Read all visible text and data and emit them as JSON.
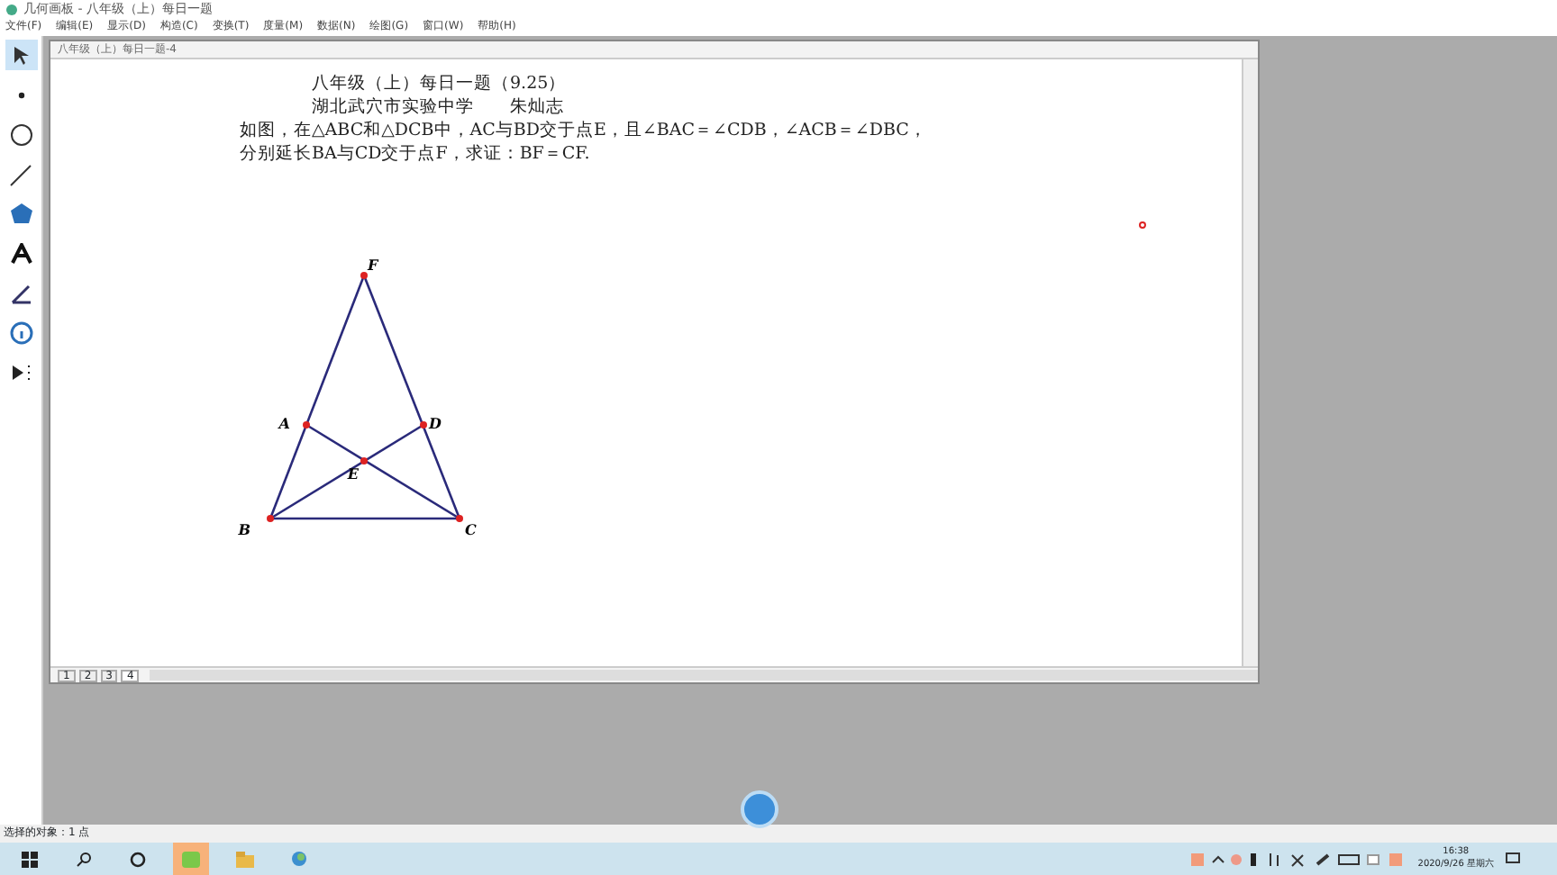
{
  "window": {
    "title": "几何画板 - 八年级（上）每日一题"
  },
  "menu": [
    "文件(F)",
    "编辑(E)",
    "显示(D)",
    "构造(C)",
    "变换(T)",
    "度量(M)",
    "数据(N)",
    "绘图(G)",
    "窗口(W)",
    "帮助(H)"
  ],
  "document": {
    "title": "八年级（上）每日一题-4",
    "lines": [
      {
        "text": "八年级（上）每日一题（9.25）",
        "kind": "center"
      },
      {
        "text": "湖北武穴市实验中学　　朱灿志",
        "kind": "center"
      },
      {
        "text": "如图，在△ABC和△DCB中，AC与BD交于点E，且∠BAC＝∠CDB，∠ACB＝∠DBC，",
        "kind": "left"
      },
      {
        "text": "分别延长BA与CD交于点F，求证：BF＝CF.",
        "kind": "left"
      }
    ],
    "points": [
      {
        "label": "F"
      },
      {
        "label": "A"
      },
      {
        "label": "D"
      },
      {
        "label": "E"
      },
      {
        "label": "B"
      },
      {
        "label": "C"
      }
    ],
    "pages": [
      {
        "label": "1",
        "selected": false
      },
      {
        "label": "2",
        "selected": false
      },
      {
        "label": "3",
        "selected": false
      },
      {
        "label": "4",
        "selected": true
      }
    ]
  },
  "status_bar": "选择的对象：1 点",
  "taskbar": {
    "time": "16:38",
    "date": "2020/9/26 星期六"
  }
}
